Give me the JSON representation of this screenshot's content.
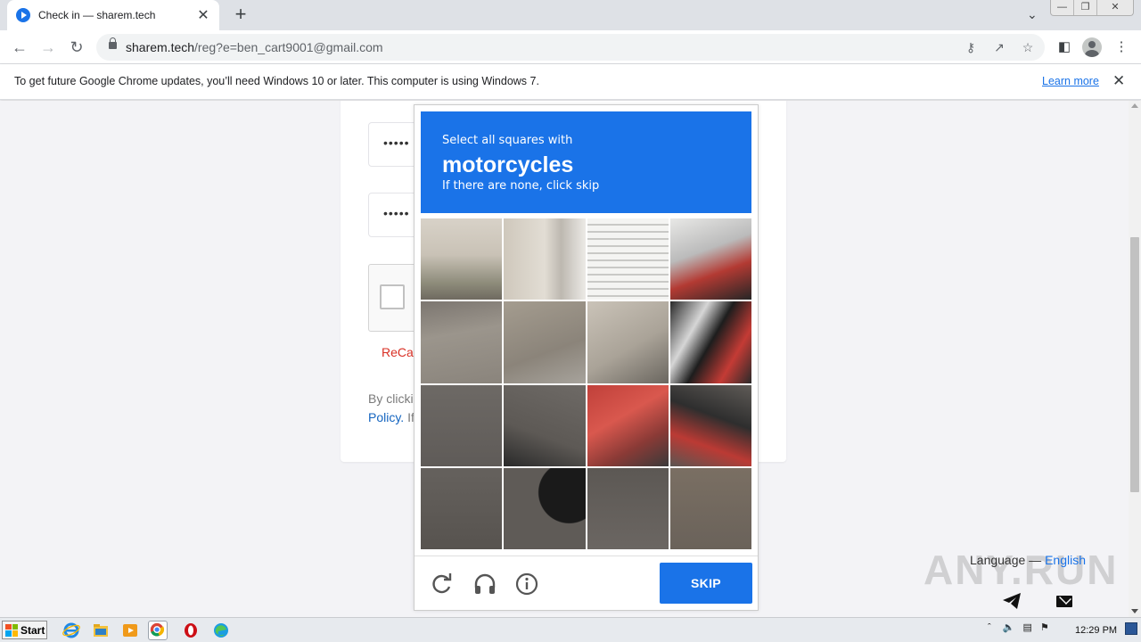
{
  "browser": {
    "tab_title": "Check in — sharem.tech",
    "tab_close": "✕",
    "new_tab": "+",
    "url_domain": "sharem.tech",
    "url_path": "/reg?e=ben_cart9001@gmail.com"
  },
  "infobar": {
    "message": "To get future Google Chrome updates, you’ll need Windows 10 or later. This computer is using Windows 7.",
    "link": "Learn more"
  },
  "form": {
    "password_mask_1": "•••••",
    "password_mask_2": "•••••",
    "recaptcha_label": "ReCap",
    "terms_line1": "By clicki",
    "terms_link": "Policy.",
    "terms_line2_rest": " If"
  },
  "captcha": {
    "instruction": "Select all squares with",
    "target": "motorcycles",
    "hint": "If there are none, click skip",
    "skip_label": "SKIP",
    "accent_color": "#1a73e8"
  },
  "footer": {
    "language_prefix": "Language — ",
    "language_value": "English",
    "watermark": "ANY.RUN"
  },
  "taskbar": {
    "start_label": "Start",
    "clock": "12:29 PM"
  }
}
